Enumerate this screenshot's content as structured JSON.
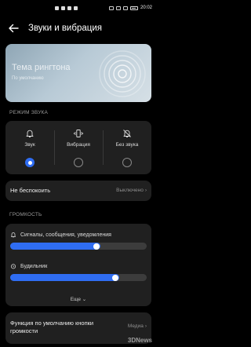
{
  "status_bar": {
    "time": "20:02"
  },
  "header": {
    "title": "Звуки и вибрация"
  },
  "banner": {
    "title": "Тема рингтона",
    "subtitle": "По умолчанию"
  },
  "sound_mode": {
    "section_label": "РЕЖИМ ЗВУКА",
    "options": [
      {
        "label": "Звук",
        "icon": "bell-icon",
        "selected": true
      },
      {
        "label": "Вибрация",
        "icon": "vibrate-icon",
        "selected": false
      },
      {
        "label": "Без звука",
        "icon": "bell-off-icon",
        "selected": false
      }
    ]
  },
  "dnd": {
    "label": "Не беспокоить",
    "value": "Выключено"
  },
  "volume": {
    "section_label": "ГРОМКОСТЬ",
    "sliders": [
      {
        "label": "Сигналы, сообщения, уведомления",
        "icon": "bell-icon",
        "level": 0.66
      },
      {
        "label": "Будильник",
        "icon": "alarm-clock-icon",
        "level": 0.8
      }
    ],
    "more_label": "Еще"
  },
  "volume_button": {
    "label": "Функция по умолчанию кнопки громкости",
    "value": "Медиа"
  },
  "watermark": "3DNews",
  "colors": {
    "accent": "#2f6df2",
    "card": "#202020",
    "background": "#000000"
  }
}
